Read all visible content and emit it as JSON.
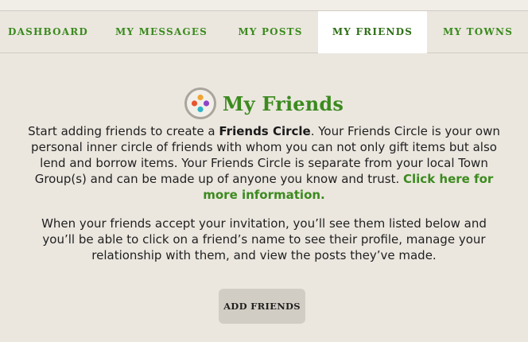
{
  "tabs": [
    {
      "label": "DASHBOARD",
      "active": false
    },
    {
      "label": "MY MESSAGES",
      "active": false
    },
    {
      "label": "MY POSTS",
      "active": false
    },
    {
      "label": "MY FRIENDS",
      "active": true
    },
    {
      "label": "MY TOWNS",
      "active": false
    }
  ],
  "section": {
    "title": "My Friends",
    "icon": "friends-circle-icon",
    "para1_before": "Start adding friends to create a ",
    "para1_bold": "Friends Circle",
    "para1_after": ". Your Friends Circle is your own personal inner circle of friends with whom you can not only gift items but also lend and borrow items. Your Friends Circle is separate from your local Town Group(s) and can be made up of anyone you know and trust. ",
    "para1_link": "Click here for more information.",
    "para2": "When your friends accept your invitation, you’ll see them listed below and you’ll be able to click on a friend’s name to see their profile, manage your relationship with them, and view the posts they’ve made.",
    "add_button": "ADD FRIENDS"
  },
  "colors": {
    "accent": "#3c8a1f",
    "background": "#ebe7df",
    "active_tab": "#ffffff",
    "button_bg": "#d2cdc4"
  }
}
